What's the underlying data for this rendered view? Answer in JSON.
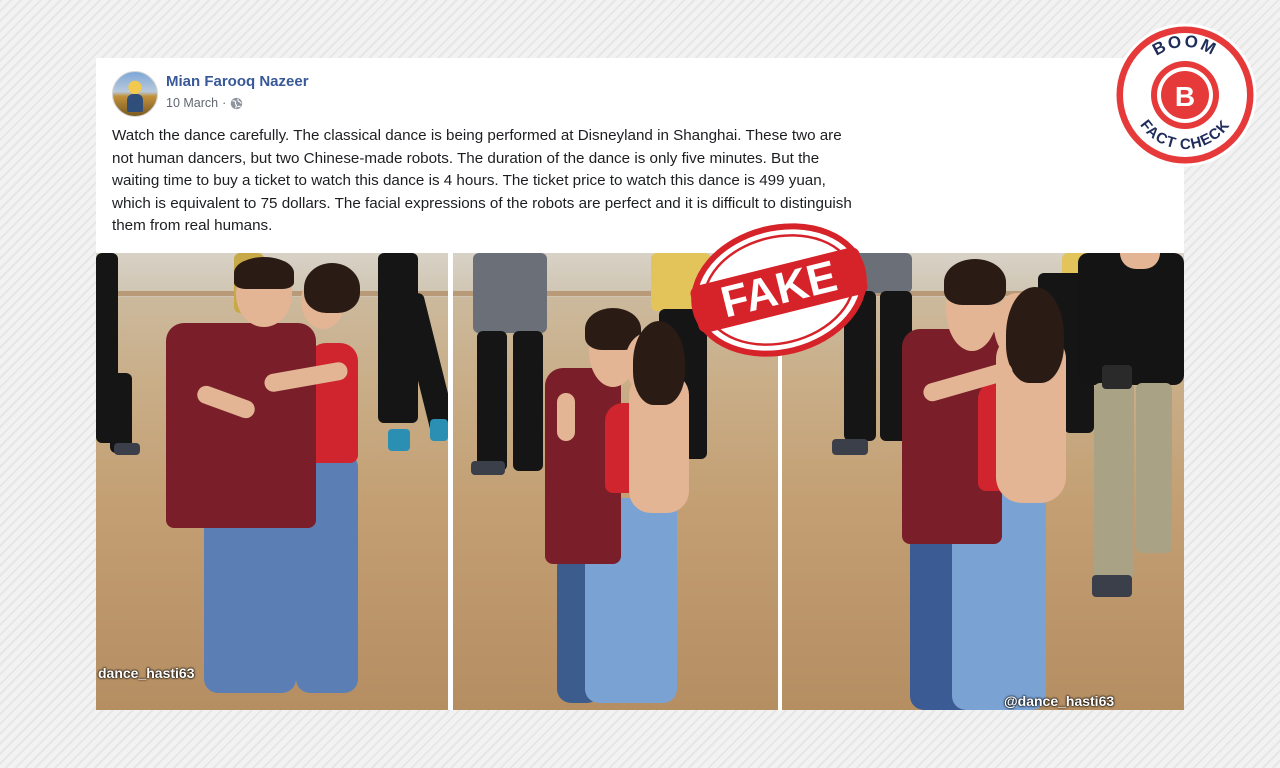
{
  "post": {
    "author": "Mian Farooq Nazeer",
    "date": "10 March",
    "separator": "·",
    "privacy_icon": "globe-icon",
    "text": "Watch the dance carefully. The classical dance is being performed at Disneyland in Shanghai. These two are not human dancers, but two Chinese-made robots. The duration of the dance is only five minutes. But the waiting time to buy a ticket to watch this dance is 4 hours. The ticket price to watch this dance is 499 yuan, which is equivalent to 75 dollars. The facial expressions of the robots are perfect and it is difficult to distinguish them from real humans."
  },
  "photos": [
    {
      "watermark": "dance_hasti63"
    },
    {
      "watermark": ""
    },
    {
      "watermark": "@dance_hasti63"
    }
  ],
  "stamp": {
    "label": "FAKE",
    "color": "#d6232a"
  },
  "badge": {
    "top": "BOOM",
    "letter": "B",
    "bottom": "FACT CHECK",
    "color": "#e63a3a",
    "navy": "#1f2d5a"
  }
}
